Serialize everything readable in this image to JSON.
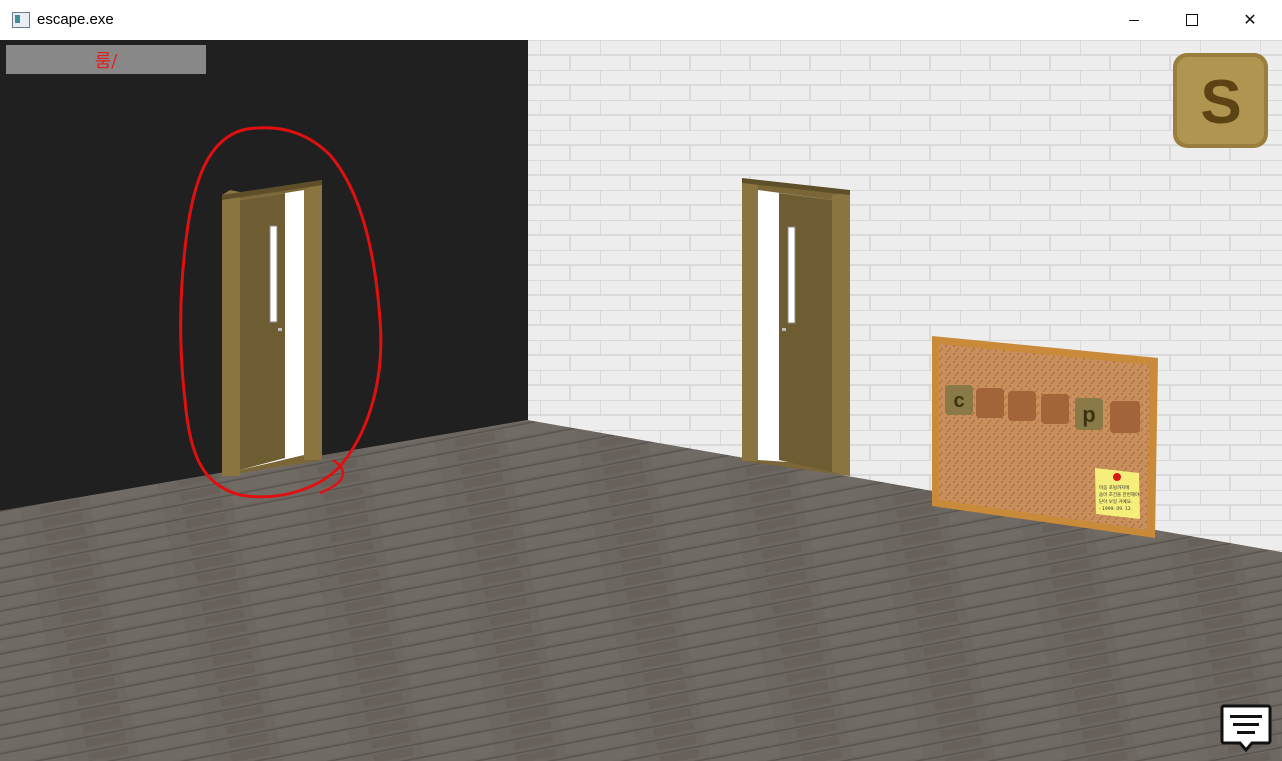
{
  "window": {
    "title": "escape.exe",
    "minimize_label": "",
    "maximize_label": "",
    "close_label": "✕"
  },
  "hud": {
    "location": "룸/",
    "save_letter": "S"
  },
  "corkboard": {
    "tiles": [
      "c",
      "",
      "",
      "",
      "p",
      ""
    ],
    "note_lines": [
      "마음 포털까지에",
      "숨어 조건을 한번해야",
      "닫아 보일 거예요.",
      "- 1999. 09. 12."
    ]
  },
  "colors": {
    "left_wall": "#202020",
    "brick_wall": "#ececec",
    "floor": "#6b6560",
    "door": "#6e5c33",
    "annotation": "#e01010",
    "hud_bg": "#888888"
  },
  "icons": {
    "save": "save-icon",
    "chat": "chat-icon"
  }
}
